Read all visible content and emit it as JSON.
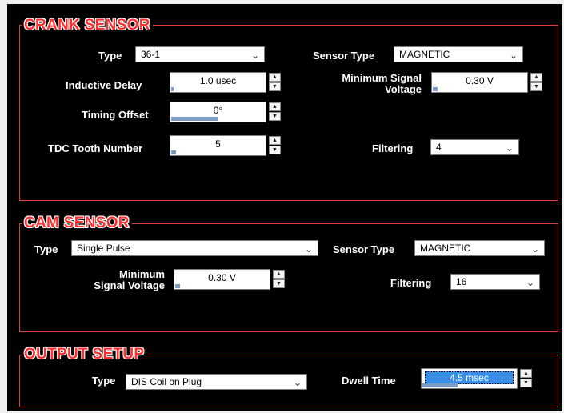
{
  "crank_sensor": {
    "title": "CRANK SENSOR",
    "type_label": "Type",
    "type_value": "36-1",
    "sensor_type_label": "Sensor Type",
    "sensor_type_value": "MAGNETIC",
    "inductive_delay_label": "Inductive Delay",
    "inductive_delay_value": "1.0 usec",
    "inductive_delay_fill": 0.02,
    "min_signal_label_1": "Minimum Signal",
    "min_signal_label_2": "Voltage",
    "min_signal_value": "0.30 V",
    "min_signal_fill": 0.05,
    "timing_offset_label": "Timing Offset",
    "timing_offset_value": "0°",
    "timing_offset_fill": 0.5,
    "tdc_label": "TDC Tooth Number",
    "tdc_value": "5",
    "tdc_fill": 0.05,
    "filtering_label": "Filtering",
    "filtering_value": "4"
  },
  "cam_sensor": {
    "title": "CAM SENSOR",
    "type_label": "Type",
    "type_value": "Single Pulse",
    "sensor_type_label": "Sensor Type",
    "sensor_type_value": "MAGNETIC",
    "min_signal_label_1": "Minimum",
    "min_signal_label_2": "Signal Voltage",
    "min_signal_value": "0.30 V",
    "min_signal_fill": 0.05,
    "filtering_label": "Filtering",
    "filtering_value": "16"
  },
  "output_setup": {
    "title": "OUTPUT SETUP",
    "type_label": "Type",
    "type_value": "DIS Coil on Plug",
    "dwell_label": "Dwell Time",
    "dwell_value": "4.5 msec",
    "dwell_fill": 0.38
  },
  "icons": {
    "spin_up": "▲",
    "spin_down": "▼",
    "chevron": "⌄"
  },
  "colors": {
    "section_title": "#ff3030",
    "frame": "#e03a3a",
    "fill_bar": "#7d9cc5",
    "selection": "#3a8ee6"
  }
}
